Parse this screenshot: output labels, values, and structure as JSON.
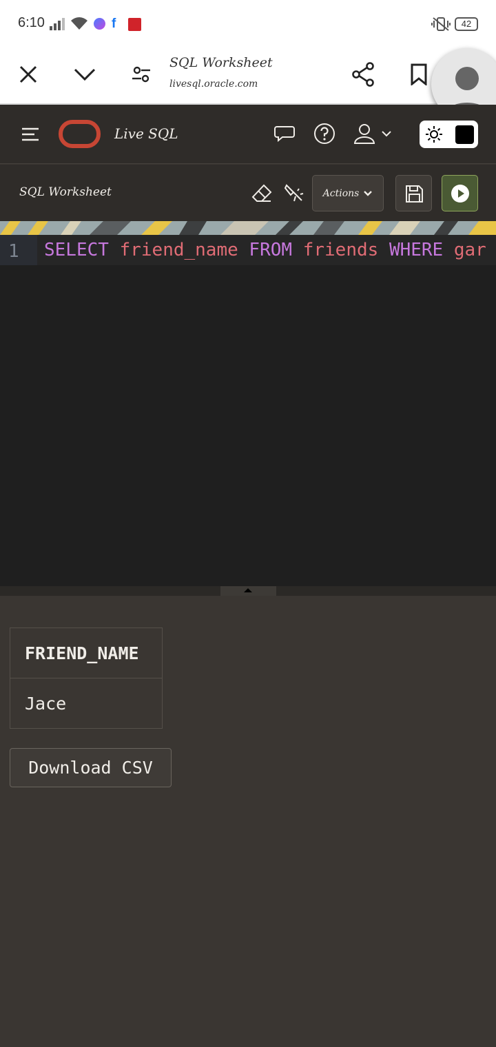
{
  "status_bar": {
    "time": "6:10",
    "battery": "42"
  },
  "browser": {
    "page_title": "SQL Worksheet",
    "url": "livesql.oracle.com"
  },
  "app": {
    "name": "Live SQL"
  },
  "toolbar": {
    "title": "SQL Worksheet",
    "actions_label": "Actions"
  },
  "editor": {
    "line_number": "1",
    "tokens": [
      "SELECT",
      " ",
      "friend_name",
      " ",
      "FROM",
      " ",
      "friends",
      " ",
      "WHERE",
      " ",
      "gar"
    ]
  },
  "results": {
    "column_header": "FRIEND_NAME",
    "rows": [
      "Jace"
    ],
    "download_label": "Download CSV"
  },
  "colors": {
    "accent": "#c74634",
    "run_button": "#4a5a34",
    "editor_bg": "#1f1f1f",
    "keyword": "#c678dd",
    "identifier": "#e06c75"
  }
}
